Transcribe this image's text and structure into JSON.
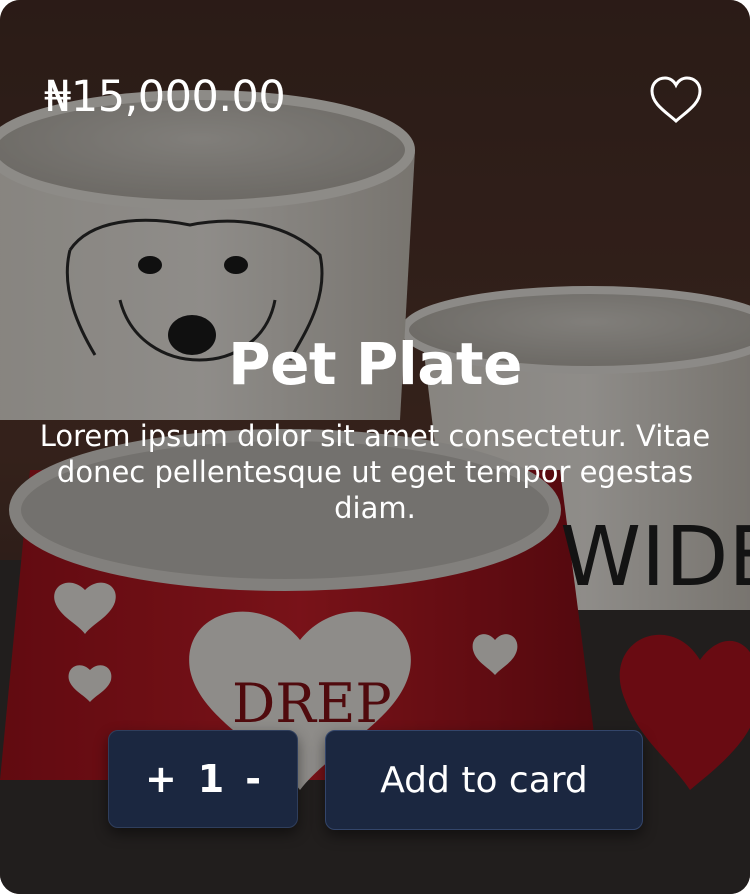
{
  "product": {
    "price": "₦15,000.00",
    "title": "Pet Plate",
    "description": "Lorem ipsum dolor sit amet consectetur. Vitae donec pellentesque ut eget tempor egestas diam."
  },
  "favorite": {
    "icon": "heart-outline-icon",
    "active": false
  },
  "quantity": {
    "increment_label": "+",
    "value": "1",
    "decrement_label": "-"
  },
  "cart": {
    "button_label": "Add to card"
  },
  "background_image": {
    "bowl_texts": {
      "bowl_red": "DREP",
      "bowl_white_right": "WIDE"
    }
  },
  "colors": {
    "button_bg": "#1b2740",
    "text": "#ffffff"
  }
}
